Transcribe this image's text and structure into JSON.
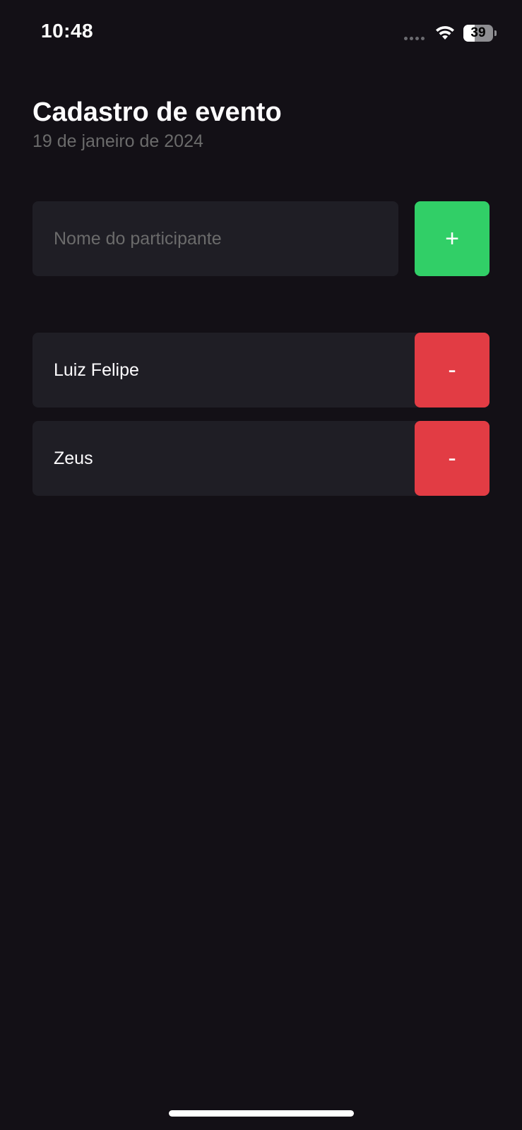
{
  "status_bar": {
    "time": "10:48",
    "battery_level": "39",
    "battery_fraction": 0.39
  },
  "header": {
    "title": "Cadastro de evento",
    "subtitle": "19 de janeiro de 2024"
  },
  "form": {
    "input_placeholder": "Nome do participante",
    "input_value": "",
    "add_label": "+"
  },
  "participants": [
    {
      "name": "Luiz Felipe",
      "remove_label": "-"
    },
    {
      "name": "Zeus",
      "remove_label": "-"
    }
  ],
  "colors": {
    "background": "#131016",
    "card": "#1F1E25",
    "add_accent": "#31CF67",
    "remove_accent": "#E23C44",
    "muted_text": "#6B6B6B"
  },
  "icons": [
    "wifi-icon",
    "battery-icon",
    "cellular-signal-icon"
  ]
}
